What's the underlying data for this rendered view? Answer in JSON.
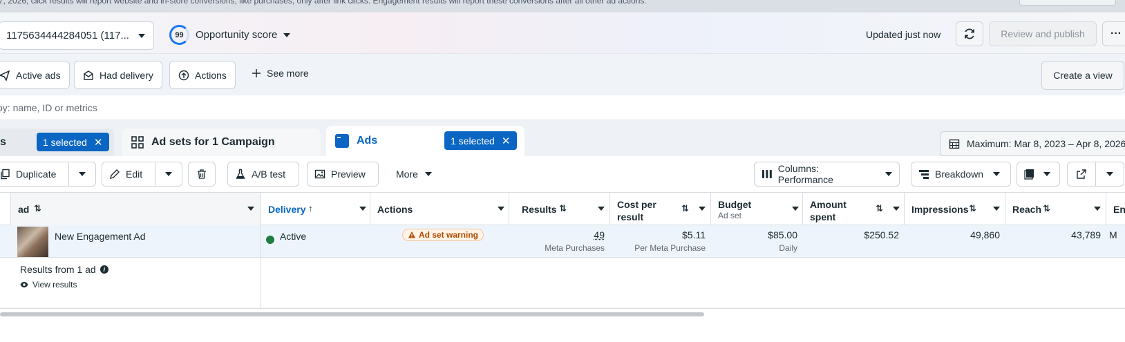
{
  "notice": {
    "text": "7, 2026, click results will report website and in-store conversions, like purchases, only after link clicks. Engagement results will report these conversions after all other ad actions."
  },
  "topbar": {
    "account_label": "1175634444284051 (117...",
    "opportunity_score": "99",
    "opportunity_label": "Opportunity score",
    "updated_text": "Updated just now",
    "review_publish_label": "Review and publish",
    "more_label": "···"
  },
  "filters": {
    "active_ads": "Active ads",
    "had_delivery": "Had delivery",
    "actions": "Actions",
    "see_more": "See more",
    "create_view": "Create a view"
  },
  "search": {
    "placeholder": "oy: name, ID or metrics"
  },
  "tabs": {
    "campaigns_partial": "s",
    "campaigns_selected": "1 selected",
    "adsets_label": "Ad sets for 1 Campaign",
    "ads_label": "Ads",
    "ads_selected": "1 selected",
    "date_range": "Maximum: Mar 8, 2023 – Apr 8, 2026"
  },
  "toolbar": {
    "duplicate": "Duplicate",
    "edit": "Edit",
    "ab_test": "A/B test",
    "preview": "Preview",
    "more": "More",
    "columns": "Columns: Performance",
    "breakdown": "Breakdown"
  },
  "table": {
    "headers": {
      "ad": "ad",
      "delivery": "Delivery",
      "actions": "Actions",
      "results": "Results",
      "cost_per_result_1": "Cost per",
      "cost_per_result_2": "result",
      "budget": "Budget",
      "budget_sub": "Ad set",
      "amount_spent_1": "Amount",
      "amount_spent_2": "spent",
      "impressions": "Impressions",
      "reach": "Reach",
      "ends_partial": "En"
    },
    "row": {
      "name": "New Engagement Ad",
      "delivery": "Active",
      "warning": "Ad set warning",
      "results": "49",
      "results_sub": "Meta Purchases",
      "cost_per_result": "$5.11",
      "cost_sub": "Per Meta Purchase",
      "budget": "$85.00",
      "budget_sub": "Daily",
      "amount_spent": "$250.52",
      "impressions": "49,860",
      "reach": "43,789",
      "ends_partial": "M"
    },
    "summary": {
      "title": "Results from 1 ad",
      "link": "View results"
    }
  },
  "colors": {
    "accent": "#0a66c2",
    "active_dot": "#1e7d3f",
    "warning": "#b04a00"
  }
}
